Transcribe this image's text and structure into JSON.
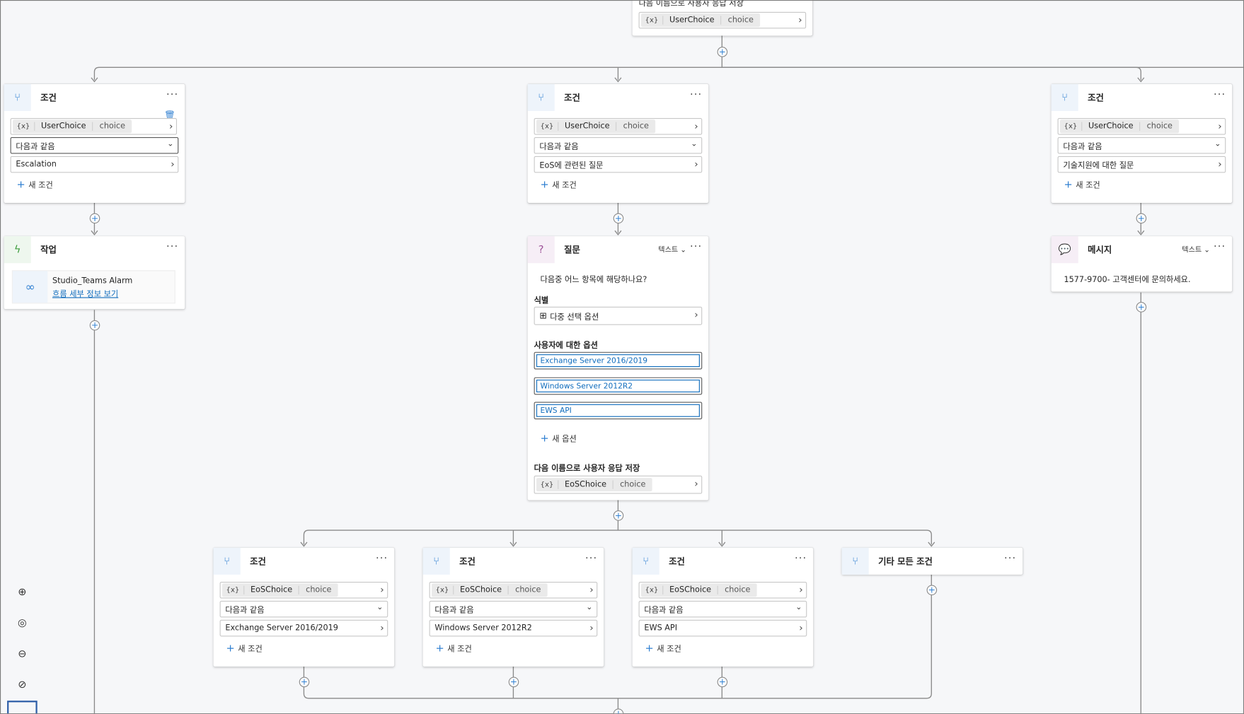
{
  "top_node": {
    "label": "다음 이름으로 사용자 응답 저장",
    "var_icon": "{x}",
    "var_name": "UserChoice",
    "var_type": "choice"
  },
  "conditions_top": [
    {
      "title": "조건",
      "var_icon": "{x}",
      "var_name": "UserChoice",
      "var_type": "choice",
      "operator": "다음과 같음",
      "value": "Escalation",
      "add_label": "새 조건",
      "more": "···"
    },
    {
      "title": "조건",
      "var_icon": "{x}",
      "var_name": "UserChoice",
      "var_type": "choice",
      "operator": "다음과 같음",
      "value": "EoS에 관련된 질문",
      "add_label": "새 조건",
      "more": "···"
    },
    {
      "title": "조건",
      "var_icon": "{x}",
      "var_name": "UserChoice",
      "var_type": "choice",
      "operator": "다음과 같음",
      "value": "기술지원에 대한 질문",
      "add_label": "새 조건",
      "more": "···"
    }
  ],
  "action_node": {
    "title": "작업",
    "flow_name": "Studio_Teams Alarm",
    "flow_link": "흐름 세부 정보 보기",
    "more": "···"
  },
  "question_node": {
    "title": "질문",
    "type_label": "텍스트",
    "more": "···",
    "prompt": "다음중 어느 항목에 해당하나요?",
    "identify_label": "식별",
    "identify_value": "다중 선택 옵션",
    "options_label": "사용자에 대한 옵션",
    "options": [
      "Exchange Server 2016/2019",
      "Windows Server 2012R2",
      "EWS API"
    ],
    "add_option": "새 옵션",
    "save_label": "다음 이름으로 사용자 응답 저장",
    "var_icon": "{x}",
    "var_name": "EoSChoice",
    "var_type": "choice"
  },
  "message_node": {
    "title": "메시지",
    "type_label": "텍스트",
    "more": "···",
    "text": "1577-9700- 고객센터에 문의하세요."
  },
  "conditions_bottom": [
    {
      "title": "조건",
      "var_icon": "{x}",
      "var_name": "EoSChoice",
      "var_type": "choice",
      "operator": "다음과 같음",
      "value": "Exchange Server 2016/2019",
      "add_label": "새 조건",
      "more": "···"
    },
    {
      "title": "조건",
      "var_icon": "{x}",
      "var_name": "EoSChoice",
      "var_type": "choice",
      "operator": "다음과 같음",
      "value": "Windows Server 2012R2",
      "add_label": "새 조건",
      "more": "···"
    },
    {
      "title": "조건",
      "var_icon": "{x}",
      "var_name": "EoSChoice",
      "var_type": "choice",
      "operator": "다음과 같음",
      "value": "EWS API",
      "add_label": "새 조건",
      "more": "···"
    }
  ],
  "else_node": {
    "title": "기타 모든 조건",
    "more": "···"
  },
  "zoom_controls": [
    "zoom-in-icon",
    "recenter-icon",
    "zoom-out-icon",
    "reset-icon",
    "minimap-icon"
  ],
  "accent_color": "#2f7fd1"
}
